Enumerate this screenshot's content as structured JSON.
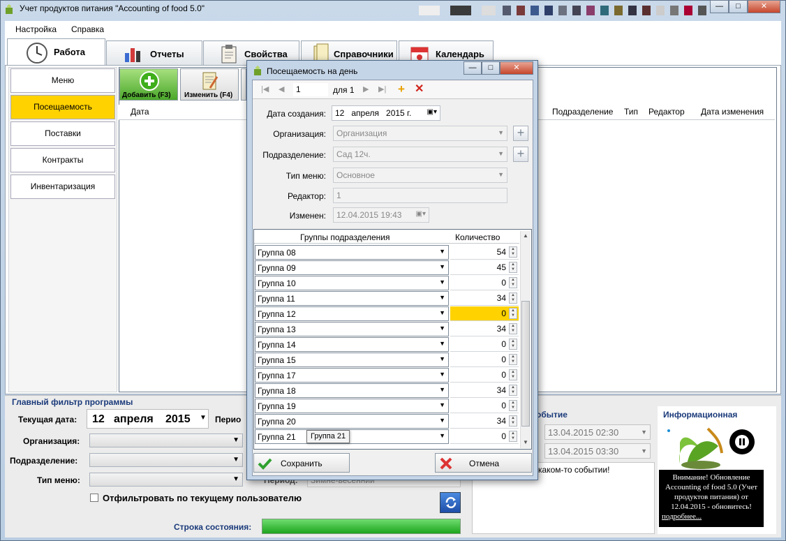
{
  "window": {
    "title": "Учет продуктов питания \"Accounting of food 5.0\"",
    "min": "—",
    "max": "□",
    "close": "✕"
  },
  "menu": [
    "Настройка",
    "Справка"
  ],
  "tabs": [
    "Работа",
    "Отчеты",
    "Свойства",
    "Справочники",
    "Календарь"
  ],
  "sidebar": [
    "Меню",
    "Посещаемость",
    "Поставки",
    "Контракты",
    "Инвентаризация"
  ],
  "toolbar": {
    "add": "Добавить (F3)",
    "edit": "Изменить (F4)"
  },
  "grid": {
    "columns": [
      "Дата",
      "Подразделение",
      "Тип",
      "Редактор",
      "Дата изменения"
    ]
  },
  "filter": {
    "title": "Главный фильтр программы",
    "date_label": "Текущая дата:",
    "date_day": "12",
    "date_month": "апреля",
    "date_year": "2015",
    "period_label": "Перио",
    "org_label": "Организация:",
    "dept_label": "Подразделение:",
    "menu_type_label": "Тип меню:",
    "user_filter_label": "Отфильтровать по текущему пользователю",
    "status_label": "Строка состояния:",
    "period2_label": "Период:",
    "period2_value": "Зимне-весенний"
  },
  "events": {
    "title": "обытие",
    "date1": "13.04.2015 02:30",
    "date2": "13.04.2015 03:30",
    "text": "каком-то событии!"
  },
  "info": {
    "title": "Информационная",
    "message": "Внимание! Обновление Accounting of food 5.0 (Учет продуктов питания) от 12.04.2015 - обновитесь!",
    "more": "подробнее..."
  },
  "dialog": {
    "title": "Посещаемость на день",
    "nav_page": "1",
    "nav_of": "для 1",
    "labels": {
      "created": "Дата создания:",
      "org": "Организация:",
      "dept": "Подразделение:",
      "menu_type": "Тип меню:",
      "editor": "Редактор:",
      "changed": "Изменен:"
    },
    "values": {
      "created_day": "12",
      "created_month": "апреля",
      "created_year": "2015 г.",
      "org": "Организация",
      "dept": "Сад 12ч.",
      "menu_type": "Основное",
      "editor": "1",
      "changed": "12.04.2015 19:43"
    },
    "grid_headers": [
      "Группы подразделения",
      "Количество"
    ],
    "rows": [
      {
        "group": "Группа 08",
        "qty": "54"
      },
      {
        "group": "Группа 09",
        "qty": "45"
      },
      {
        "group": "Группа 10",
        "qty": "0"
      },
      {
        "group": "Группа 11",
        "qty": "34"
      },
      {
        "group": "Группа 12",
        "qty": "0"
      },
      {
        "group": "Группа 13",
        "qty": "34"
      },
      {
        "group": "Группа 14",
        "qty": "0"
      },
      {
        "group": "Группа 15",
        "qty": "0"
      },
      {
        "group": "Группа 17",
        "qty": "0"
      },
      {
        "group": "Группа 18",
        "qty": "34"
      },
      {
        "group": "Группа 19",
        "qty": "0"
      },
      {
        "group": "Группа 20",
        "qty": "34"
      },
      {
        "group": "Группа 21",
        "qty": "0"
      }
    ],
    "tooltip": "Группа 21",
    "save": "Сохранить",
    "cancel": "Отмена"
  },
  "colors": {
    "accent": "#ffd200",
    "status": "#1ea51e"
  }
}
